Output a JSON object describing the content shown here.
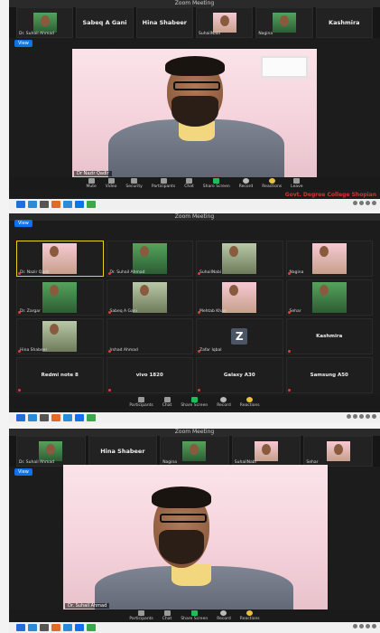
{
  "panel1": {
    "window_title": "Zoom Meeting",
    "strip": [
      {
        "kind": "video",
        "label": "Dr. Suhail Ahmad",
        "thumb": "green"
      },
      {
        "kind": "name",
        "name": "Sabeq A Gani"
      },
      {
        "kind": "name",
        "name": "Hina Shabeer"
      },
      {
        "kind": "video",
        "label": "SuhailNabi",
        "thumb": "pink"
      },
      {
        "kind": "video",
        "label": "Nagina",
        "thumb": "green"
      },
      {
        "kind": "name",
        "name": "Kashmira"
      }
    ],
    "speaker_chip": "View",
    "speaker_name": "Dr Nazir Qadir",
    "controls": [
      "Mute",
      "Video",
      "Security",
      "Participants",
      "Chat",
      "Share Screen",
      "Record",
      "Reactions",
      "Leave"
    ],
    "overlay_text": "Govt. Degree College Shopian"
  },
  "panel2": {
    "window_title": "Zoom Meeting",
    "view_chip": "View",
    "grid": [
      {
        "kind": "video",
        "label": "Dr. Nazir Qadir",
        "active": true
      },
      {
        "kind": "video",
        "label": "Dr. Suhail Ahmad"
      },
      {
        "kind": "video",
        "label": "SuhailNabi"
      },
      {
        "kind": "video",
        "label": "Nagina"
      },
      {
        "kind": "video",
        "label": "Dr. Zargar"
      },
      {
        "kind": "video",
        "label": "Sabeq A Gani"
      },
      {
        "kind": "video",
        "label": "Mehtab Khan"
      },
      {
        "kind": "video",
        "label": "Sehar"
      },
      {
        "kind": "video",
        "label": "Hina Shabeer"
      },
      {
        "kind": "name",
        "name": "",
        "label": "Irshad Ahmad"
      },
      {
        "kind": "z",
        "label": "Zafar Iqbal"
      },
      {
        "kind": "name",
        "name": "Kashmira"
      },
      {
        "kind": "name",
        "name": "Redmi note 8"
      },
      {
        "kind": "name",
        "name": "vivo 1820"
      },
      {
        "kind": "name",
        "name": "Galaxy A30"
      },
      {
        "kind": "name",
        "name": "Samsung A50"
      }
    ],
    "controls": [
      "Participants",
      "Chat",
      "Share Screen",
      "Record",
      "Reactions"
    ]
  },
  "panel3": {
    "window_title": "Zoom Meeting",
    "strip": [
      {
        "kind": "video",
        "label": "Dr. Suhail Ahmad",
        "thumb": "green"
      },
      {
        "kind": "name",
        "name": "Hina Shabeer"
      },
      {
        "kind": "video",
        "label": "Nagina",
        "thumb": "green"
      },
      {
        "kind": "video",
        "label": "SuhailNabi",
        "thumb": "pink"
      },
      {
        "kind": "video",
        "label": "Sehar",
        "thumb": "pink"
      }
    ],
    "speaker_chip": "View",
    "speaker_name": "Dr. Suhail Ahmad",
    "controls": [
      "Participants",
      "Chat",
      "Share Screen",
      "Record",
      "Reactions"
    ]
  },
  "colors": {
    "accent": "#0e72ed",
    "active_border": "#e4d21b",
    "share_green": "#1fbd5c",
    "overlay_red": "#d8332b"
  }
}
